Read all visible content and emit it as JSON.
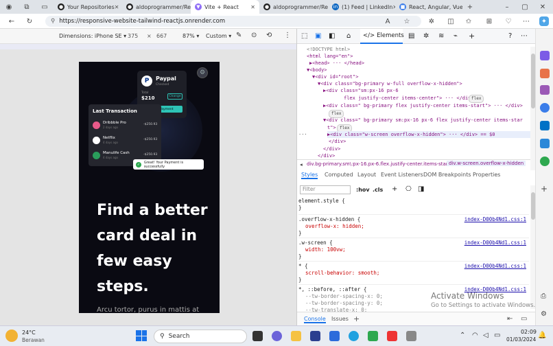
{
  "browser": {
    "tabs": [
      {
        "label": "Your Repositories",
        "icon": "github-icon"
      },
      {
        "label": "aldoprogrammer/Resp...",
        "icon": "github-icon"
      },
      {
        "label": "Vite + React",
        "icon": "vite-icon"
      },
      {
        "label": "aldoprogrammer/Resp...",
        "icon": "github-icon"
      },
      {
        "label": "(1) Feed | LinkedIn",
        "icon": "linkedin-icon"
      },
      {
        "label": "React, Angular, Vue, ...",
        "icon": "bookmark-icon"
      }
    ],
    "url": "https://responsive-website-tailwind-reactjs.onrender.com"
  },
  "device_toolbar": {
    "dimensions_label": "Dimensions: iPhone SE ▾",
    "width": "375",
    "times": "×",
    "height": "667",
    "zoom": "87% ▾",
    "throttle": "Custom ▾"
  },
  "app": {
    "paypal_title": "Paypal",
    "paypal_sub": "Checked",
    "total_label": "Total",
    "total": "$210",
    "change": "Change",
    "make_payment": "Make Payment",
    "last_tx_title": "Last Transaction",
    "transactions": [
      {
        "name": "Dribbble Pro",
        "time": "2 days ago",
        "amount": "-$250.93",
        "color": "#e85a8a"
      },
      {
        "name": "Netflix",
        "time": "4 days ago",
        "amount": "-$250.93",
        "color": "#ffffff"
      },
      {
        "name": "Manulife Cash",
        "time": "4 days ago",
        "amount": "-$250.93",
        "color": "#2a9d5b"
      }
    ],
    "toast": "Great! Your Payment is successfully",
    "hero_lines": [
      "Find a better",
      "card deal in",
      "few easy",
      "steps."
    ],
    "sub": "Arcu tortor, purus in mattis at"
  },
  "devtools": {
    "elements_tab": "Elements",
    "dom": [
      {
        "t": "<!DOCTYPE html>"
      },
      {
        "t": "<html lang=\"en\">"
      },
      {
        "t": "▶<head> ··· </head>"
      },
      {
        "t": "▼<body>"
      },
      {
        "t": "▼<div id=\"root\">"
      },
      {
        "t": "▼<div class=\"bg-primary w-full overflow-x-hidden\">"
      },
      {
        "t": "▶<div class=\"sm:px-16 px-6"
      },
      {
        "t": "flex justify-center items-center\"> ··· </div>"
      },
      {
        "t": "▶<div class=\" bg-primary flex justify-center items-start\"> ··· </div>"
      },
      {
        "t": ""
      },
      {
        "t": "▼<div class=\" bg-primary sm:px-16 px-6 flex justify-center items-star"
      },
      {
        "t": "t\">"
      },
      {
        "t": "▶<div class=\"w-screen overflow-x-hidden\"> ··· </div> == $0"
      },
      {
        "t": "</div>"
      },
      {
        "t": "</div>"
      },
      {
        "t": "</div>"
      }
    ],
    "pills": [
      "flex",
      "flex",
      "flex"
    ],
    "crumb1": "div.bg-primary.sm\\:px-16.px-6.flex.justify-center.items-start",
    "crumb2": "div.w-screen.overflow-x-hidden",
    "style_tabs": [
      "Styles",
      "Computed",
      "Layout",
      "Event Listeners",
      "DOM Breakpoints",
      "Properties"
    ],
    "filter_placeholder": "Filter",
    "hov": ":hov",
    "cls": ".cls",
    "rules": [
      {
        "sel": "element.style {",
        "props": [],
        "link": ""
      },
      {
        "sel": ".overflow-x-hidden {",
        "props": [
          "overflow-x: hidden;"
        ],
        "link": "index-D00b4Nd1.css:1"
      },
      {
        "sel": ".w-screen {",
        "props": [
          "width: 100vw;"
        ],
        "link": "index-D00b4Nd1.css:1"
      },
      {
        "sel": "* {",
        "props": [
          "scroll-behavior: smooth;"
        ],
        "link": "index-D00b4Nd1.css:1"
      },
      {
        "sel": "*, ::before, ::after {",
        "props": [
          "--tw-border-spacing-x: 0;",
          "--tw-border-spacing-y: 0;",
          "--tw-translate-x: 0;"
        ],
        "link": "index-D00b4Nd1.css:1"
      }
    ],
    "activate_title": "Activate Windows",
    "activate_sub": "Go to Settings to activate Windows.",
    "drawer_tabs": [
      "Console",
      "Issues"
    ]
  },
  "taskbar": {
    "temp": "24°C",
    "weather": "Berawan",
    "search": "Search",
    "time": "02:09",
    "date": "01/03/2024"
  }
}
